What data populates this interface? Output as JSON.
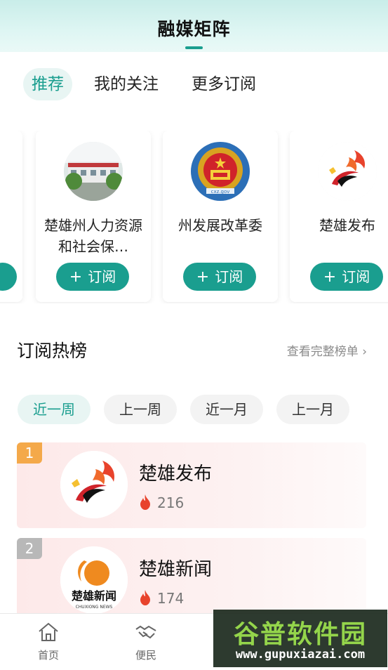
{
  "header": {
    "title": "融媒矩阵"
  },
  "tabs": [
    {
      "label": "推荐",
      "active": true
    },
    {
      "label": "我的关注",
      "active": false
    },
    {
      "label": "更多订阅",
      "active": false
    }
  ],
  "cards": [
    {
      "name": "楚雄州人力资源和社会保…",
      "button": "订阅",
      "avatar_icon": "building-photo"
    },
    {
      "name": "州发展改革委",
      "button": "订阅",
      "avatar_icon": "national-emblem"
    },
    {
      "name": "楚雄发布",
      "button": "订阅",
      "avatar_icon": "chuxiong-fabu-logo"
    }
  ],
  "ranking": {
    "title": "订阅热榜",
    "more": "查看完整榜单 ›",
    "periods": [
      {
        "label": "近一周",
        "active": true
      },
      {
        "label": "上一周",
        "active": false
      },
      {
        "label": "近一月",
        "active": false
      },
      {
        "label": "上一月",
        "active": false
      }
    ],
    "items": [
      {
        "rank": "1",
        "name": "楚雄发布",
        "heat": "216",
        "rank_color": "#f4a94a"
      },
      {
        "rank": "2",
        "name": "楚雄新闻",
        "heat": "174",
        "rank_color": "#b8b8b8"
      }
    ]
  },
  "bottom_nav": [
    {
      "label": "首页",
      "icon": "home-icon"
    },
    {
      "label": "便民",
      "icon": "handshake-icon"
    }
  ],
  "watermark": {
    "title": "谷普软件园",
    "url": "www.gupuxiazai.com"
  },
  "colors": {
    "accent": "#1a9e8f",
    "flame": "#e8432c"
  }
}
